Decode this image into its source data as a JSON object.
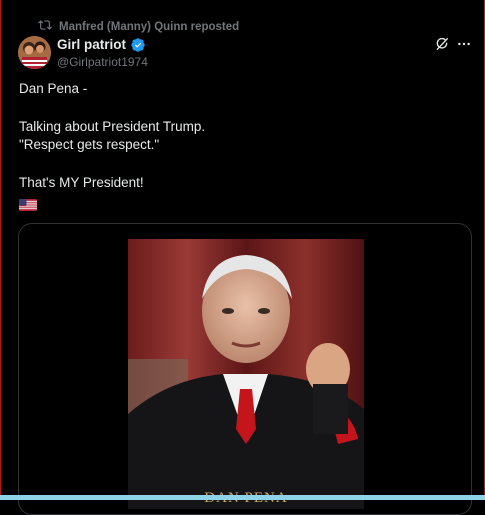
{
  "repost": {
    "text": "Manfred (Manny) Quinn reposted",
    "icon": "repost-icon"
  },
  "author": {
    "display_name": "Girl patriot",
    "handle": "@Girlpatriot1974",
    "verified_color": "#1d9bf0"
  },
  "actions": {
    "grok_icon": "grok-icon",
    "more_icon": "more-icon"
  },
  "tweet": {
    "line1": "Dan Pena -",
    "line2": "Talking about President Trump.",
    "line3": "\"Respect gets respect.\"",
    "line4": "That's MY President!",
    "emoji": "us-flag"
  },
  "media": {
    "caption": "DAN PENA"
  },
  "colors": {
    "background": "#000000",
    "text": "#e7e9ea",
    "muted": "#71767b",
    "card_border": "#2f3336"
  }
}
